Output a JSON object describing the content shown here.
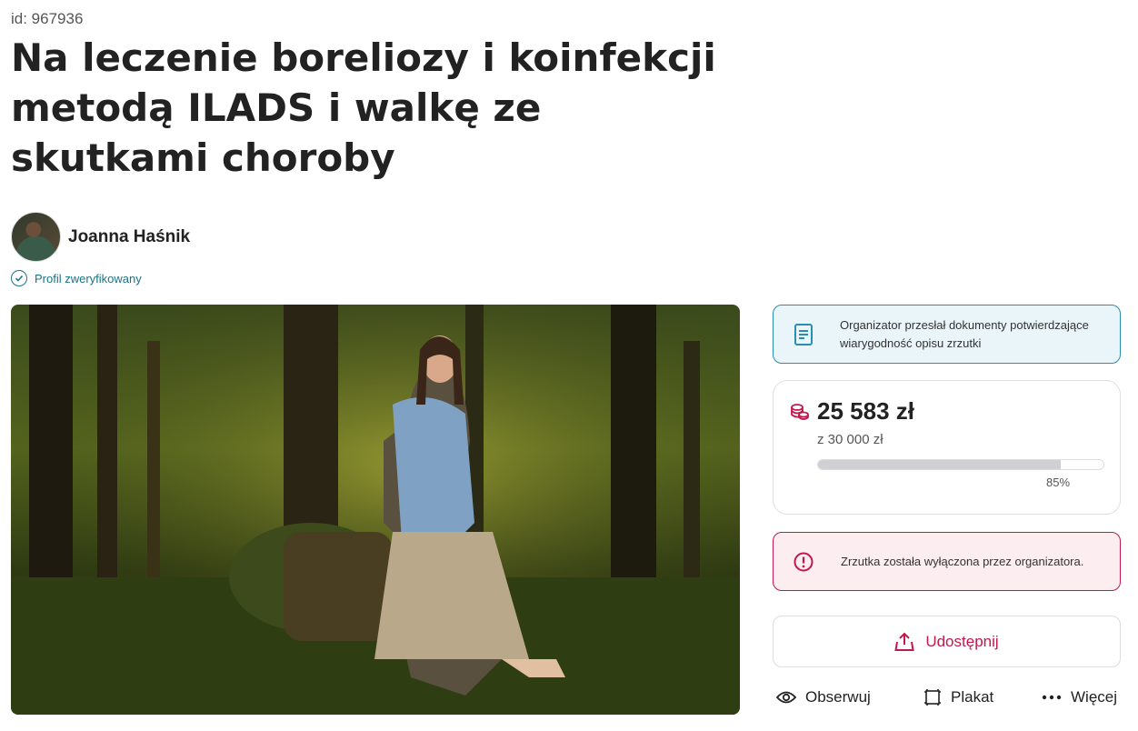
{
  "fundraiser": {
    "id_label": "id: 967936",
    "title": "Na leczenie boreliozy i koinfekcji metodą ILADS i walkę ze skutkami choroby"
  },
  "organizer": {
    "name": "Joanna Haśnik",
    "verified_label": "Profil zweryfikowany"
  },
  "notice": {
    "documents": "Organizator przesłał dokumenty potwierdzające wiarygodność opisu zrzutki",
    "disabled": "Zrzutka została wyłączona przez organizatora."
  },
  "progress": {
    "raised": "25 583 zł",
    "goal": "z 30 000 zł",
    "percent_label": "85%",
    "percent": 85
  },
  "actions": {
    "share": "Udostępnij",
    "follow": "Obserwuj",
    "poster": "Plakat",
    "more": "Więcej"
  },
  "colors": {
    "accent": "#c2184b",
    "info": "#2a8db0",
    "verified": "#1a7385"
  },
  "icons": [
    "check-circle-icon",
    "document-icon",
    "coins-icon",
    "alert-icon",
    "share-icon",
    "eye-icon",
    "poster-icon",
    "more-dots-icon"
  ]
}
